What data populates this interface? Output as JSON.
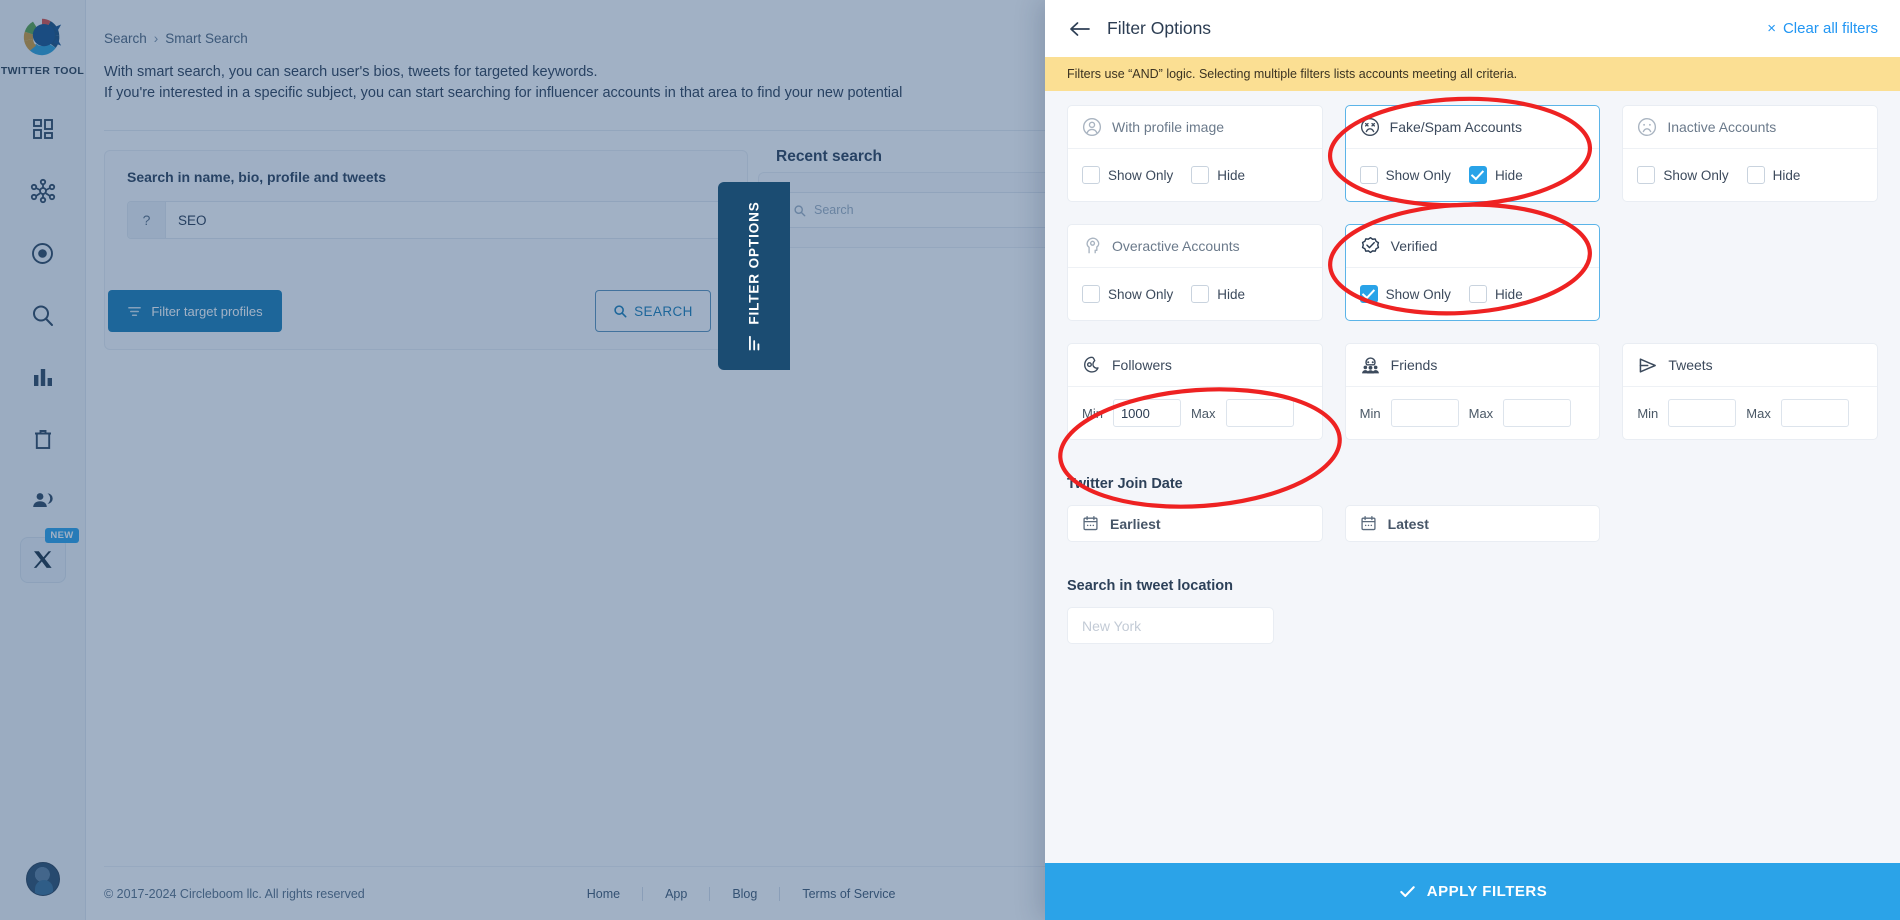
{
  "sidebar": {
    "logo_text": "TWITTER TOOL",
    "items": [
      {
        "name": "dashboard",
        "icon": "grid-icon"
      },
      {
        "name": "network",
        "icon": "network-icon"
      },
      {
        "name": "target",
        "icon": "target-icon"
      },
      {
        "name": "search",
        "icon": "search-icon"
      },
      {
        "name": "analytics",
        "icon": "bar-chart-icon"
      },
      {
        "name": "cleanup",
        "icon": "trash-icon"
      },
      {
        "name": "audience",
        "icon": "users-icon"
      },
      {
        "name": "x-platform",
        "icon": "x-icon",
        "badge": "NEW"
      }
    ]
  },
  "breadcrumb": {
    "root": "Search",
    "separator": "›",
    "current": "Smart Search"
  },
  "intro": {
    "line1": "With smart search, you can search user's bios, tweets for targeted keywords.",
    "line2": "If you're interested in a specific subject, you can start searching for influencer accounts in that area to find your new potential"
  },
  "search_card": {
    "label": "Search in name, bio, profile and tweets",
    "prefix": "?",
    "value": "SEO",
    "filter_button": "Filter target profiles",
    "search_button": "SEARCH"
  },
  "recent": {
    "title": "Recent search",
    "search_placeholder": "Search"
  },
  "filter_tab": {
    "label": "FILTER OPTIONS"
  },
  "footer": {
    "copyright": "© 2017-2024 Circleboom llc. All rights reserved",
    "links": [
      "Home",
      "App",
      "Blog",
      "Terms of Service"
    ]
  },
  "panel": {
    "title": "Filter Options",
    "clear_all": "Clear all filters",
    "clear_all_icon": "×",
    "notice": "Filters use “AND” logic. Selecting multiple filters lists accounts meeting all criteria.",
    "apply_label": "APPLY FILTERS",
    "toggle_cards": [
      {
        "id": "with-profile-image",
        "title": "With profile image",
        "icon": "user-circle-icon",
        "active": false,
        "title_dark": false,
        "options": [
          {
            "label": "Show Only",
            "checked": false
          },
          {
            "label": "Hide",
            "checked": false
          }
        ]
      },
      {
        "id": "fake-spam-accounts",
        "title": "Fake/Spam Accounts",
        "icon": "sad-face-icon",
        "active": true,
        "title_dark": true,
        "options": [
          {
            "label": "Show Only",
            "checked": false
          },
          {
            "label": "Hide",
            "checked": true
          }
        ]
      },
      {
        "id": "inactive-accounts",
        "title": "Inactive Accounts",
        "icon": "frown-face-icon",
        "active": false,
        "title_dark": false,
        "options": [
          {
            "label": "Show Only",
            "checked": false
          },
          {
            "label": "Hide",
            "checked": false
          }
        ]
      },
      {
        "id": "overactive-accounts",
        "title": "Overactive Accounts",
        "icon": "head-gear-icon",
        "active": false,
        "title_dark": false,
        "options": [
          {
            "label": "Show Only",
            "checked": false
          },
          {
            "label": "Hide",
            "checked": false
          }
        ]
      },
      {
        "id": "verified",
        "title": "Verified",
        "icon": "verified-badge-icon",
        "active": true,
        "title_dark": true,
        "options": [
          {
            "label": "Show Only",
            "checked": true
          },
          {
            "label": "Hide",
            "checked": false
          }
        ]
      }
    ],
    "range_cards": [
      {
        "id": "followers",
        "title": "Followers",
        "icon": "followers-icon",
        "min_label": "Min",
        "max_label": "Max",
        "min_value": "1000",
        "max_value": ""
      },
      {
        "id": "friends",
        "title": "Friends",
        "icon": "friends-icon",
        "min_label": "Min",
        "max_label": "Max",
        "min_value": "",
        "max_value": ""
      },
      {
        "id": "tweets",
        "title": "Tweets",
        "icon": "send-icon",
        "min_label": "Min",
        "max_label": "Max",
        "min_value": "",
        "max_value": ""
      }
    ],
    "join_date": {
      "section_title": "Twitter Join Date",
      "earliest_label": "Earliest",
      "latest_label": "Latest",
      "icon": "calendar-icon"
    },
    "location": {
      "section_title": "Search in tweet location",
      "placeholder": "New York",
      "value": ""
    }
  },
  "annotations": {
    "color": "#ee2222",
    "ellipses": [
      "fake-spam-card",
      "verified-card",
      "followers-card"
    ]
  }
}
